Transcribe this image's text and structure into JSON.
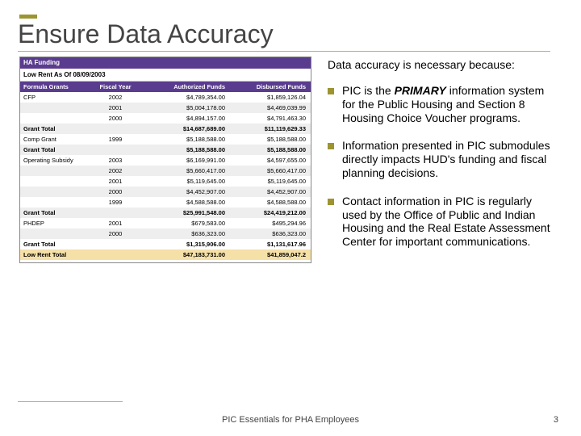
{
  "title": "Ensure Data Accuracy",
  "table": {
    "header": "HA Funding",
    "sub": "Low Rent As Of  08/09/2003",
    "cols": [
      "Formula Grants",
      "Fiscal Year",
      "Authorized Funds",
      "Disbursed Funds"
    ],
    "rows": [
      {
        "c1": "CFP",
        "c2": "2002",
        "c3": "$4,789,354.00",
        "c4": "$1,859,126.04",
        "alt": false
      },
      {
        "c1": "",
        "c2": "2001",
        "c3": "$5,004,178.00",
        "c4": "$4,469,039.99",
        "alt": true
      },
      {
        "c1": "",
        "c2": "2000",
        "c3": "$4,894,157.00",
        "c4": "$4,791,463.30",
        "alt": false
      },
      {
        "c1": "Grant Total",
        "c2": "",
        "c3": "$14,687,689.00",
        "c4": "$11,119,629.33",
        "alt": true,
        "gt": true
      },
      {
        "c1": "Comp Grant",
        "c2": "1999",
        "c3": "$5,188,588.00",
        "c4": "$5,188,588.00",
        "alt": false
      },
      {
        "c1": "Grant Total",
        "c2": "",
        "c3": "$5,188,588.00",
        "c4": "$5,188,588.00",
        "alt": true,
        "gt": true
      },
      {
        "c1": "Operating Subsidy",
        "c2": "2003",
        "c3": "$6,169,991.00",
        "c4": "$4,597,655.00",
        "alt": false
      },
      {
        "c1": "",
        "c2": "2002",
        "c3": "$5,660,417.00",
        "c4": "$5,660,417.00",
        "alt": true
      },
      {
        "c1": "",
        "c2": "2001",
        "c3": "$5,119,645.00",
        "c4": "$5,119,645.00",
        "alt": false
      },
      {
        "c1": "",
        "c2": "2000",
        "c3": "$4,452,907.00",
        "c4": "$4,452,907.00",
        "alt": true
      },
      {
        "c1": "",
        "c2": "1999",
        "c3": "$4,588,588.00",
        "c4": "$4,588,588.00",
        "alt": false
      },
      {
        "c1": "Grant Total",
        "c2": "",
        "c3": "$25,991,548.00",
        "c4": "$24,419,212.00",
        "alt": true,
        "gt": true
      },
      {
        "c1": "PHDEP",
        "c2": "2001",
        "c3": "$679,583.00",
        "c4": "$495,294.96",
        "alt": false
      },
      {
        "c1": "",
        "c2": "2000",
        "c3": "$636,323.00",
        "c4": "$636,323.00",
        "alt": true
      },
      {
        "c1": "Grant Total",
        "c2": "",
        "c3": "$1,315,906.00",
        "c4": "$1,131,617.96",
        "alt": false,
        "gt": true
      },
      {
        "c1": "Low Rent Total",
        "c2": "",
        "c3": "$47,183,731.00",
        "c4": "$41,859,047.2",
        "lrt": true,
        "gt": true
      }
    ]
  },
  "intro": "Data accuracy is necessary because:",
  "bullets": [
    {
      "pre": "PIC is the ",
      "em": "PRIMARY",
      "post": " information system for the Public Housing and Section 8 Housing Choice Voucher programs."
    },
    {
      "pre": "Information presented in PIC submodules directly impacts HUD's funding and fiscal planning decisions.",
      "em": "",
      "post": ""
    },
    {
      "pre": "Contact information in PIC is regularly used by the Office of Public and Indian Housing and the Real Estate Assessment Center for important communications.",
      "em": "",
      "post": ""
    }
  ],
  "footer": "PIC Essentials for PHA Employees",
  "pagenum": "3"
}
